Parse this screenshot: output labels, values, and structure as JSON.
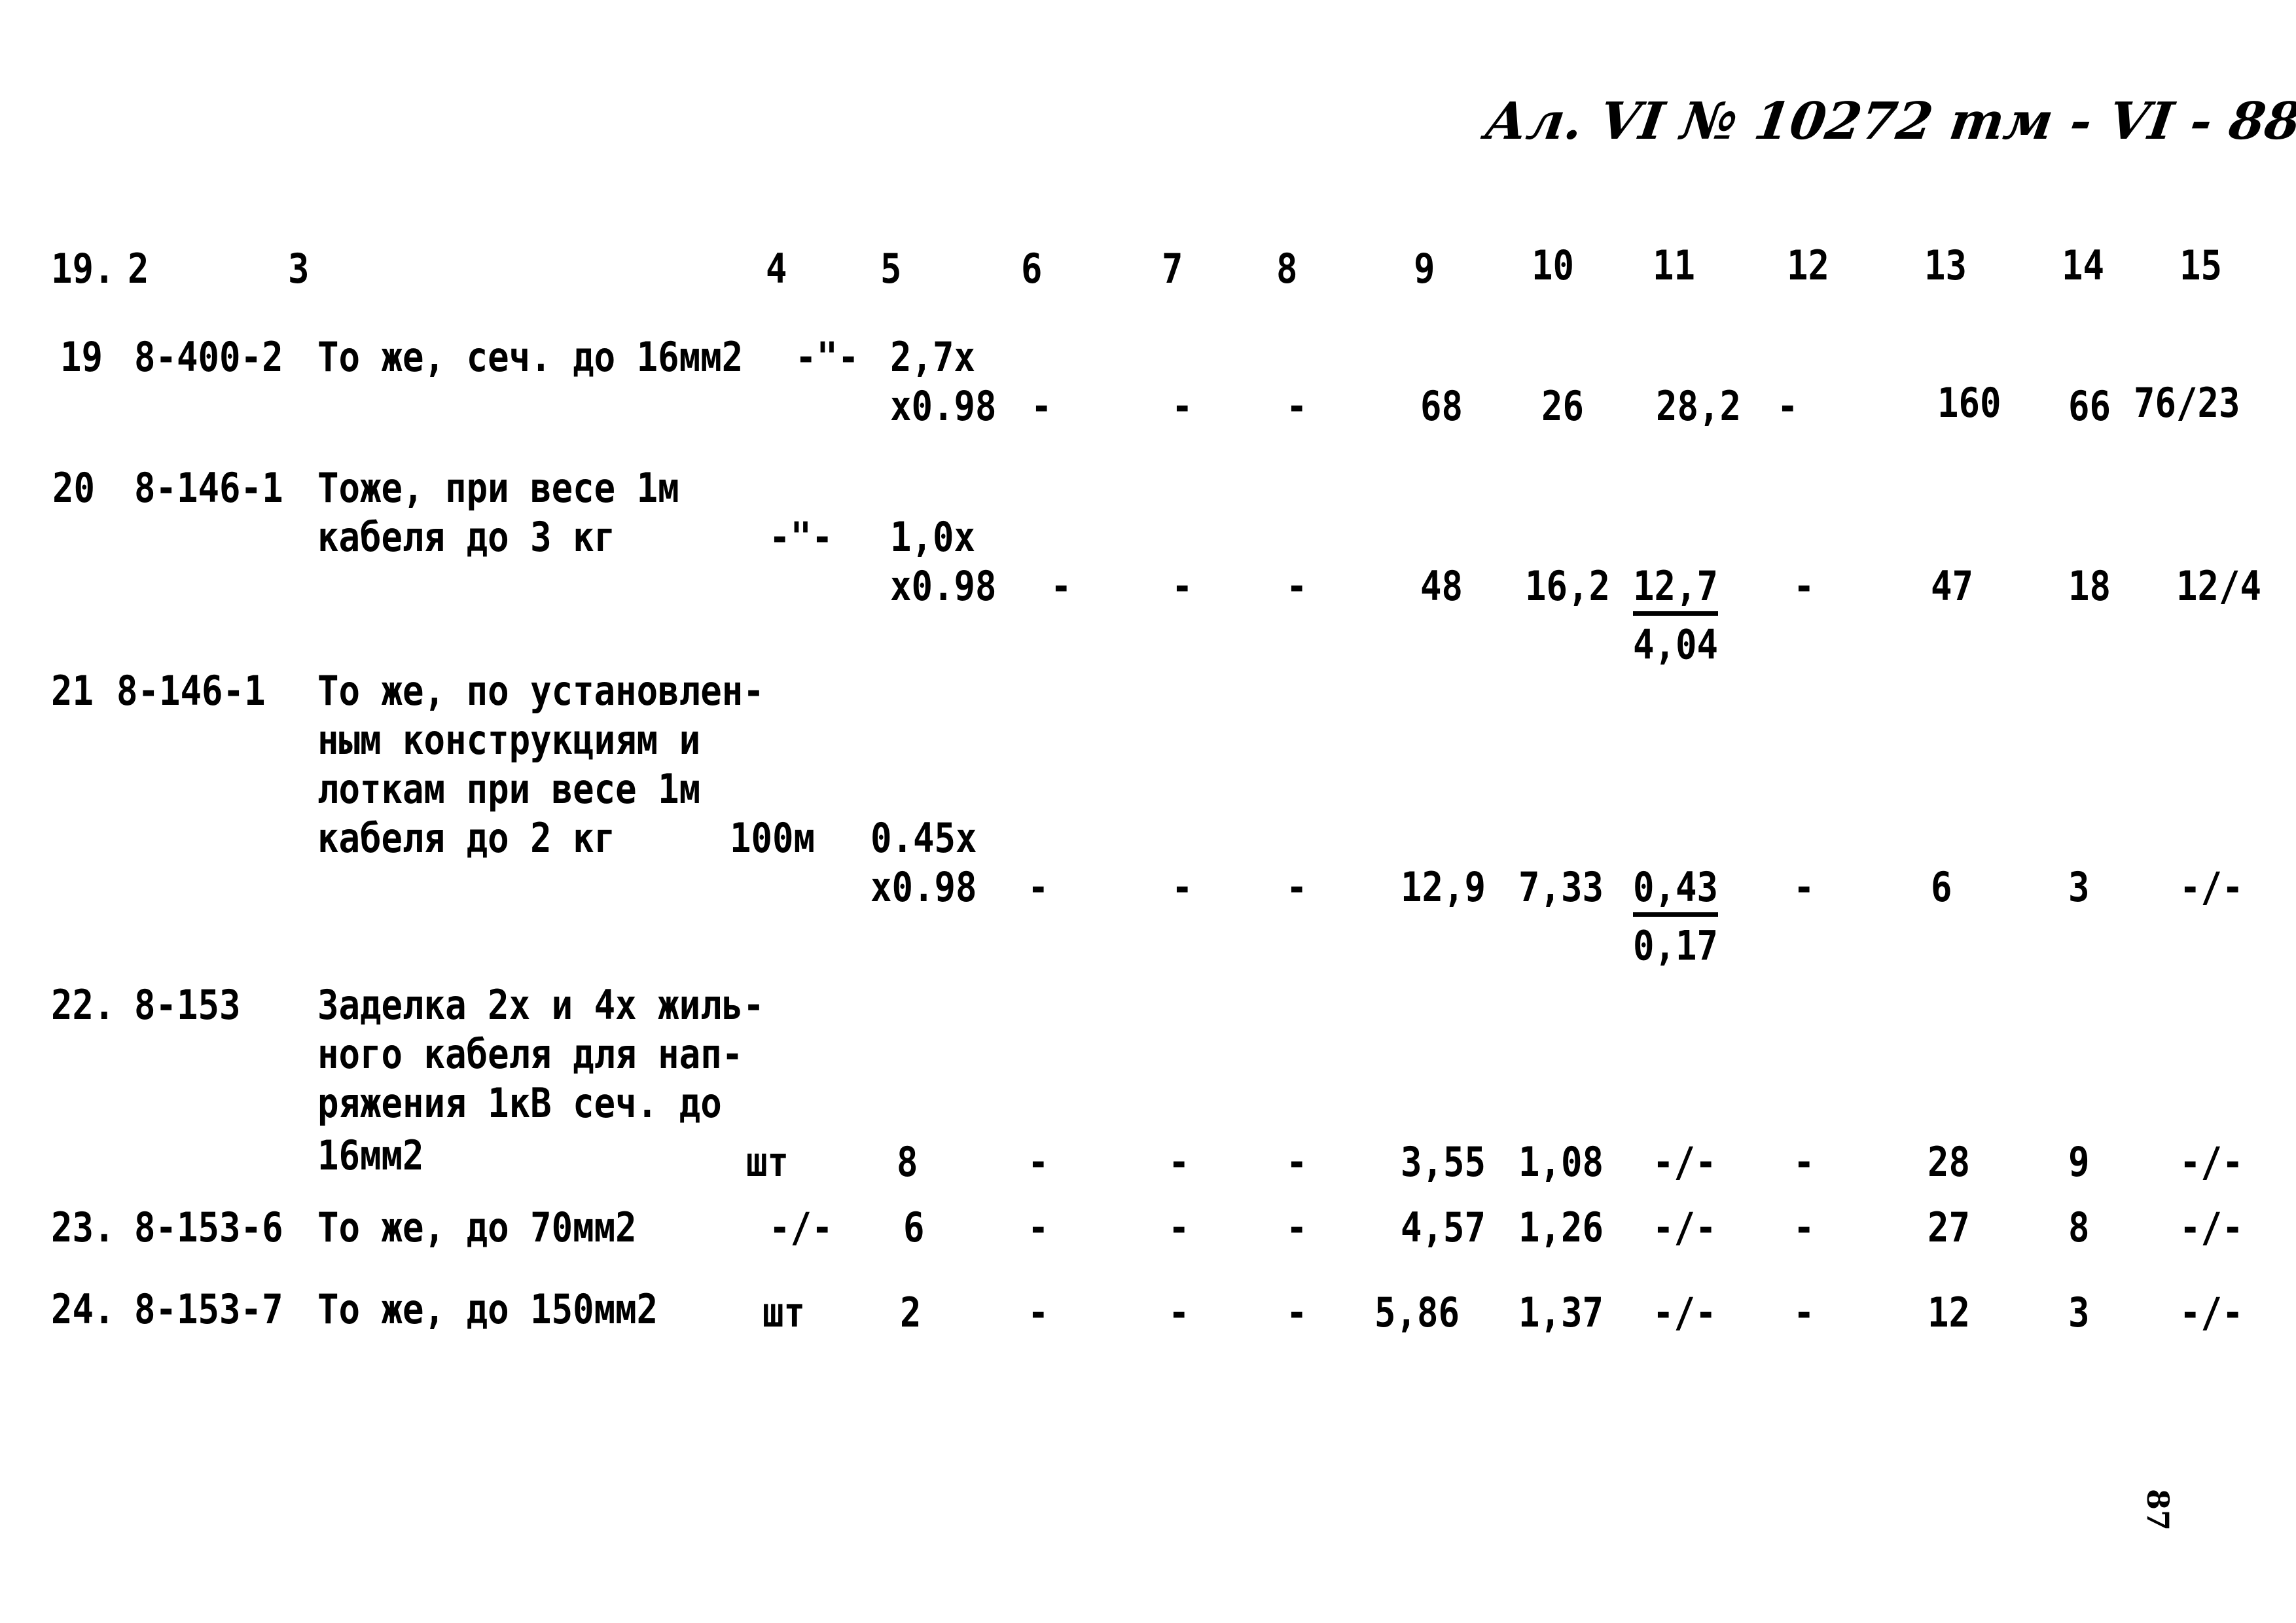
{
  "document": {
    "header_stamp": "Ал. VI № 10272 тм - VI - 88",
    "page_number": "87",
    "column_headers": [
      "19.",
      "2",
      "3",
      "4",
      "5",
      "6",
      "7",
      "8",
      "9",
      "10",
      "11",
      "12",
      "13",
      "14",
      "15"
    ],
    "rows": [
      {
        "num": "19",
        "code": "8-400-2",
        "desc": [
          "То же, сеч. до 16мм2"
        ],
        "unit": "-\"-",
        "qty": [
          "2,7х",
          "х0.98"
        ],
        "c6": "-",
        "c7": "-",
        "c8": "-",
        "c9": "68",
        "c10": "26",
        "c11": "28,2",
        "c11_den": "",
        "c12": "-",
        "c13": "160",
        "c14": "66",
        "c15": "76/23"
      },
      {
        "num": "20",
        "code": "8-146-1",
        "desc": [
          "Тоже, при весе 1м",
          "кабеля до 3 кг"
        ],
        "unit": "-\"-",
        "qty": [
          "1,0х",
          "х0.98"
        ],
        "c6": "-",
        "c7": "-",
        "c8": "-",
        "c9": "48",
        "c10": "16,2",
        "c11": "12,7",
        "c11_den": "4,04",
        "c12": "-",
        "c13": "47",
        "c14": "18",
        "c15": "12/4"
      },
      {
        "num": "21",
        "code": "8-146-1",
        "desc": [
          "То же, по установлен-",
          "ным конструкциям и",
          "лоткам при весе 1м",
          "кабеля  до 2 кг"
        ],
        "unit": "100м",
        "qty": [
          "0.45х",
          "х0.98"
        ],
        "c6": "-",
        "c7": "-",
        "c8": "-",
        "c9": "12,9",
        "c10": "7,33",
        "c11": "0,43",
        "c11_den": "0,17",
        "c12": "-",
        "c13": "6",
        "c14": "3",
        "c15": "-/-"
      },
      {
        "num": "22.",
        "code": "8-153",
        "desc": [
          "Заделка 2х и 4х жиль-",
          "ного кабеля для нап-",
          "ряжения 1кВ сеч. до",
          "16мм2"
        ],
        "unit": "шт",
        "qty": [
          "8"
        ],
        "c6": "-",
        "c7": "-",
        "c8": "-",
        "c9": "3,55",
        "c10": "1,08",
        "c11": "-/-",
        "c11_den": "",
        "c12": "-",
        "c13": "28",
        "c14": "9",
        "c15": "-/-"
      },
      {
        "num": "23.",
        "code": "8-153-6",
        "desc": [
          "То же, до 70мм2"
        ],
        "unit": "-/-",
        "qty": [
          "6"
        ],
        "c6": "-",
        "c7": "-",
        "c8": "-",
        "c9": "4,57",
        "c10": "1,26",
        "c11": "-/-",
        "c11_den": "",
        "c12": "-",
        "c13": "27",
        "c14": "8",
        "c15": "-/-"
      },
      {
        "num": "24.",
        "code": "8-153-7",
        "desc": [
          "То же, до 150мм2"
        ],
        "unit": "шт",
        "qty": [
          "2"
        ],
        "c6": "-",
        "c7": "-",
        "c8": "-",
        "c9": "5,86",
        "c10": "1,37",
        "c11": "-/-",
        "c11_den": "",
        "c12": "-",
        "c13": "12",
        "c14": "3",
        "c15": "-/-"
      }
    ]
  }
}
